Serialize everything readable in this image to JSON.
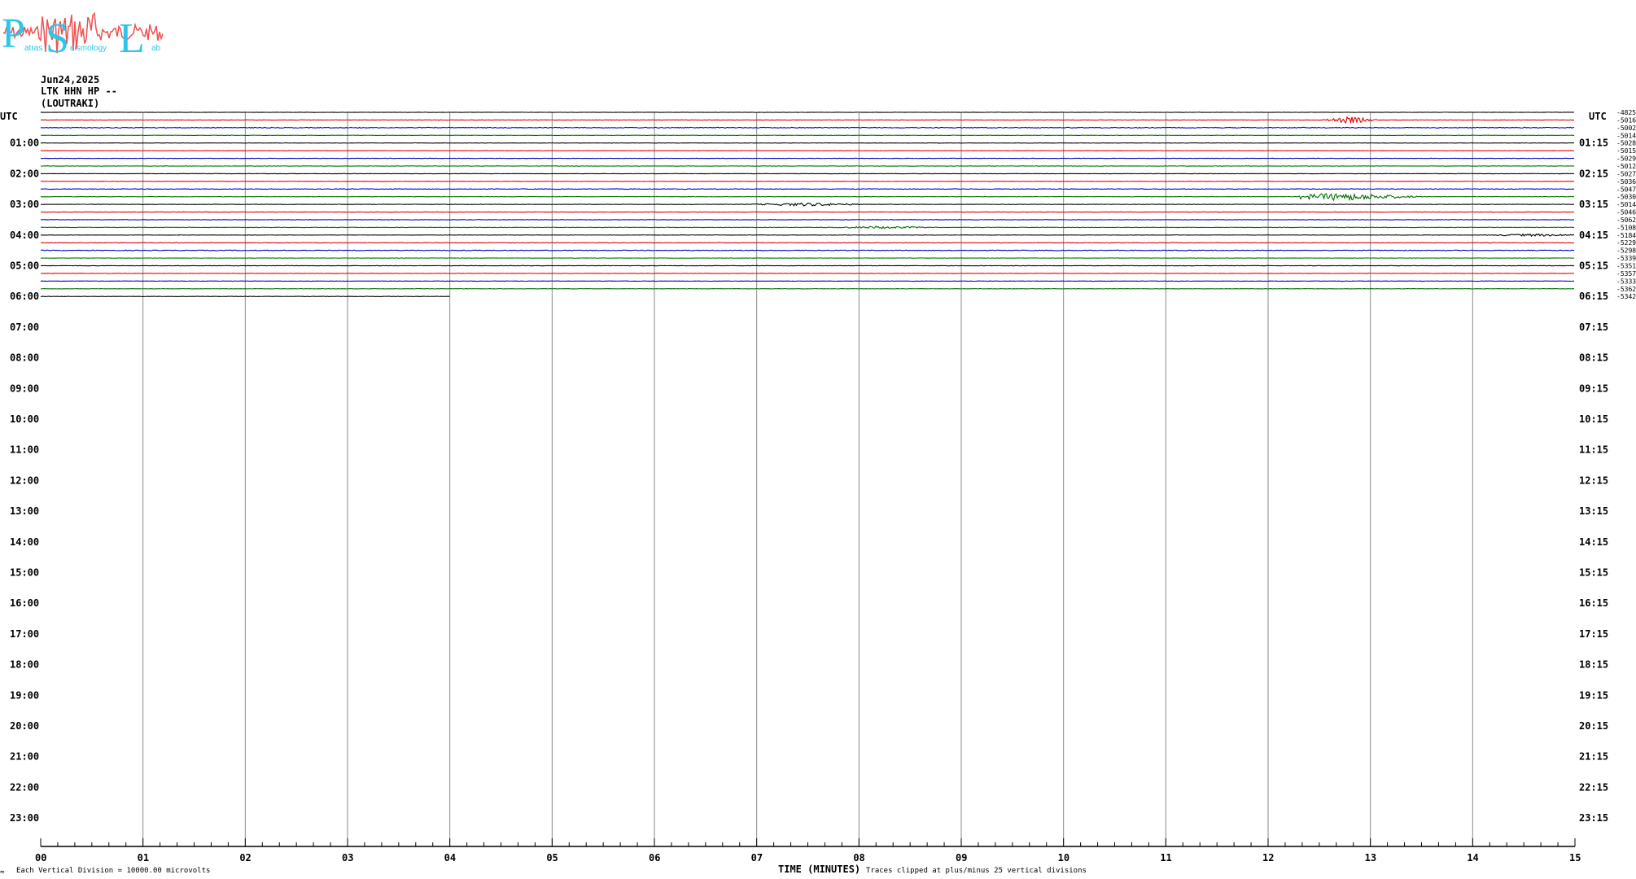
{
  "logo": {
    "big_letters": [
      "P",
      "S",
      "L"
    ],
    "small_words": [
      "atras",
      "eismology",
      "ab"
    ],
    "wave_color": "#f05050",
    "letter_color": "#2cc6e8"
  },
  "header": {
    "date": "Jun24,2025",
    "station": "LTK HHN HP --",
    "location": "(LOUTRAKI)"
  },
  "axis": {
    "left_title": "UTC",
    "right_title": "UTC",
    "left_hours": [
      "01:00",
      "02:00",
      "03:00",
      "04:00",
      "05:00",
      "06:00",
      "07:00",
      "08:00",
      "09:00",
      "10:00",
      "11:00",
      "12:00",
      "13:00",
      "14:00",
      "15:00",
      "16:00",
      "17:00",
      "18:00",
      "19:00",
      "20:00",
      "21:00",
      "22:00",
      "23:00"
    ],
    "right_hours": [
      "01:15",
      "02:15",
      "03:15",
      "04:15",
      "05:15",
      "06:15",
      "07:15",
      "08:15",
      "09:15",
      "10:15",
      "11:15",
      "12:15",
      "13:15",
      "14:15",
      "15:15",
      "16:15",
      "17:15",
      "18:15",
      "19:15",
      "20:15",
      "21:15",
      "22:15",
      "23:15"
    ],
    "minute_labels": [
      "00",
      "01",
      "02",
      "03",
      "04",
      "05",
      "06",
      "07",
      "08",
      "09",
      "10",
      "11",
      "12",
      "13",
      "14",
      "15"
    ],
    "xlabel": "TIME (MINUTES)"
  },
  "footer": {
    "scale_note": "Each Vertical Division = 10000.00 microvolts",
    "clip_note": "Traces clipped at plus/minus 25 vertical divisions",
    "corner_mark": "≈"
  },
  "chart_data": {
    "type": "line",
    "title": "",
    "xlabel": "TIME (MINUTES)",
    "xlim": [
      0,
      15
    ],
    "row_minutes": 15,
    "rows_total": 96,
    "trace_colors": [
      "#000000",
      "#e00000",
      "#0000c8",
      "#007000"
    ],
    "rows": [
      {
        "offset": "-4825",
        "level": 0.15,
        "events": []
      },
      {
        "offset": "-5016",
        "level": 0.2,
        "events": [
          {
            "start": 12.5,
            "end": 13.1,
            "peak": 12.8,
            "amp": 0.8
          }
        ]
      },
      {
        "offset": "-5002",
        "level": 0.45,
        "events": []
      },
      {
        "offset": "-5014",
        "level": 0.2,
        "events": []
      },
      {
        "offset": "-5028",
        "level": 0.2,
        "events": []
      },
      {
        "offset": "-5015",
        "level": 0.15,
        "events": []
      },
      {
        "offset": "-5029",
        "level": 0.2,
        "events": []
      },
      {
        "offset": "-5012",
        "level": 0.25,
        "events": []
      },
      {
        "offset": "-5027",
        "level": 0.2,
        "events": []
      },
      {
        "offset": "-5036",
        "level": 0.2,
        "events": []
      },
      {
        "offset": "-5047",
        "level": 0.35,
        "events": []
      },
      {
        "offset": "-5030",
        "level": 0.2,
        "events": [
          {
            "start": 12.3,
            "end": 13.6,
            "peak": 12.7,
            "amp": 0.9
          }
        ]
      },
      {
        "offset": "-5014",
        "level": 0.25,
        "events": [
          {
            "start": 6.8,
            "end": 8.2,
            "peak": 7.5,
            "amp": 0.4
          }
        ]
      },
      {
        "offset": "-5046",
        "level": 0.2,
        "events": []
      },
      {
        "offset": "-5062",
        "level": 0.25,
        "events": []
      },
      {
        "offset": "-5108",
        "level": 0.25,
        "events": [
          {
            "start": 7.5,
            "end": 8.8,
            "peak": 8.2,
            "amp": 0.3
          }
        ]
      },
      {
        "offset": "-5184",
        "level": 0.2,
        "events": [
          {
            "start": 14.0,
            "end": 15.0,
            "peak": 14.6,
            "amp": 0.3
          }
        ]
      },
      {
        "offset": "-5229",
        "level": 0.35,
        "events": []
      },
      {
        "offset": "-5298",
        "level": 0.4,
        "events": []
      },
      {
        "offset": "-5339",
        "level": 0.2,
        "events": []
      },
      {
        "offset": "-5351",
        "level": 0.2,
        "events": []
      },
      {
        "offset": "-5357",
        "level": 0.2,
        "events": []
      },
      {
        "offset": "-5333",
        "level": 0.2,
        "events": []
      },
      {
        "offset": "-5362",
        "level": 0.2,
        "events": []
      },
      {
        "offset": "-5342",
        "level": 0.2,
        "events": [],
        "end_minute": 4.0
      }
    ]
  }
}
